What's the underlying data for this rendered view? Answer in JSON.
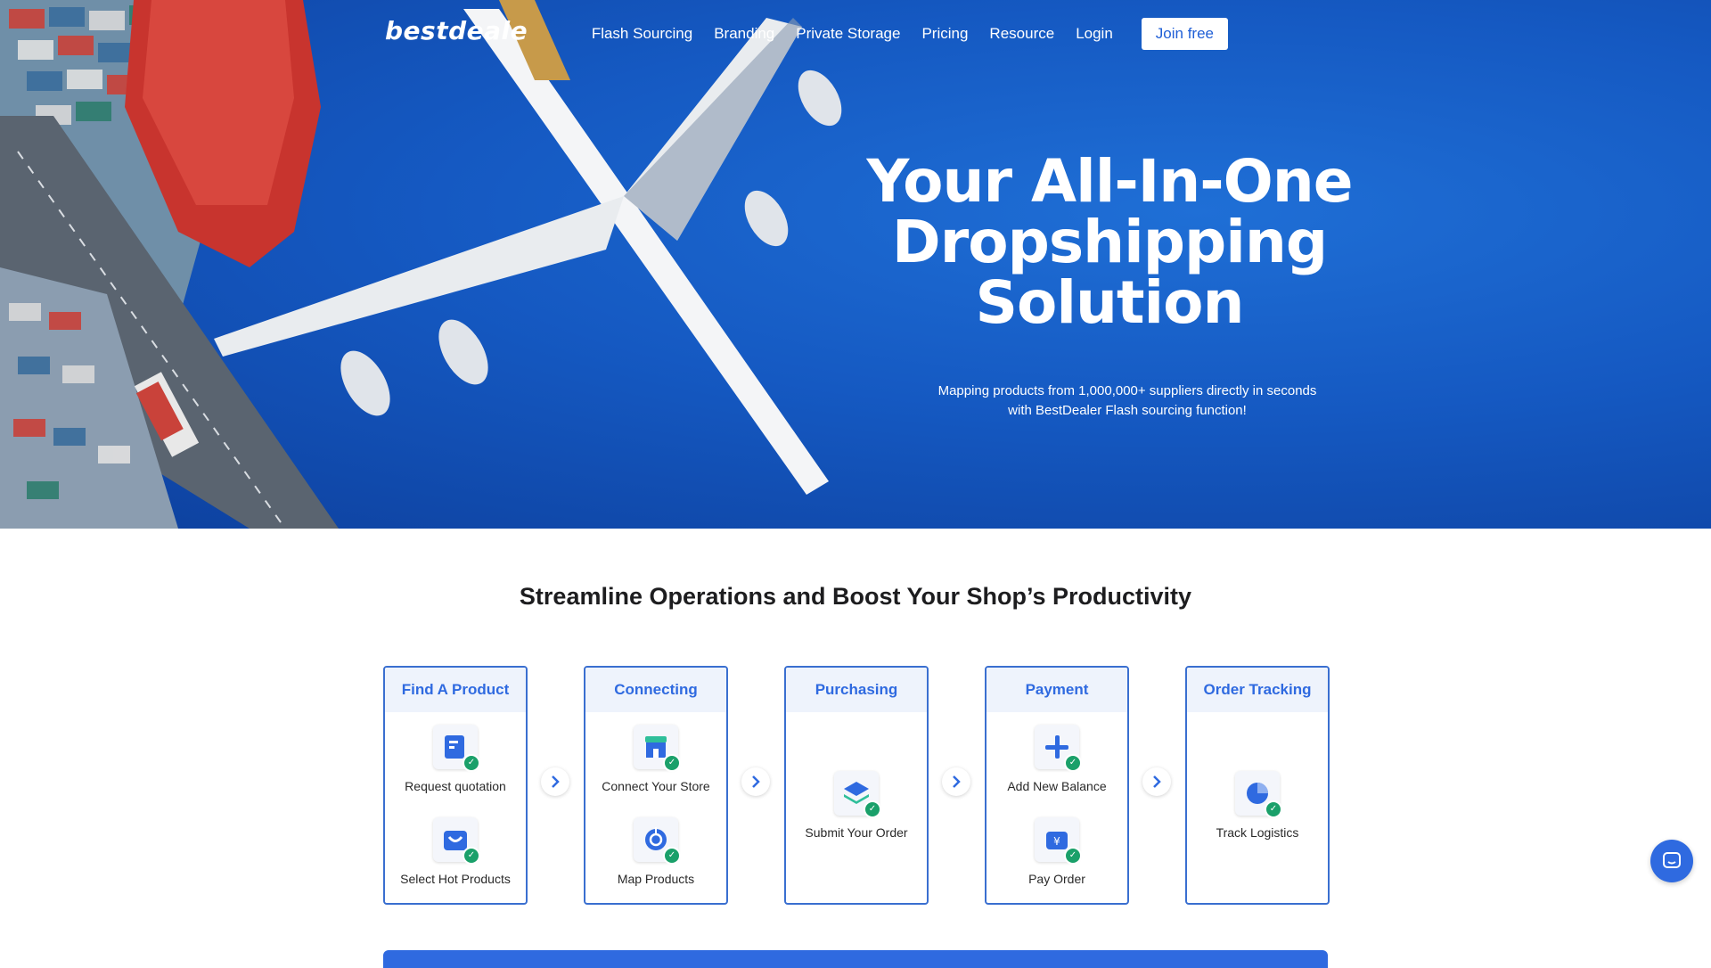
{
  "brand": {
    "logo_text": "bestdeale",
    "accent": "#2f6ae0"
  },
  "nav": {
    "items": [
      {
        "label": "Flash Sourcing"
      },
      {
        "label": "Branding"
      },
      {
        "label": "Private Storage"
      },
      {
        "label": "Pricing"
      },
      {
        "label": "Resource"
      },
      {
        "label": "Login"
      }
    ],
    "join_label": "Join free"
  },
  "hero": {
    "title_lines": [
      "Your All-In-One",
      "Dropshipping",
      "Solution"
    ],
    "subtitle_lines": [
      "Mapping products from 1,000,000+ suppliers directly in seconds",
      "with BestDealer Flash sourcing function!"
    ]
  },
  "section": {
    "title": "Streamline Operations and Boost Your Shop’s Productivity"
  },
  "steps": [
    {
      "title": "Find A Product",
      "items": [
        {
          "label": "Request quotation",
          "icon": "quotation-icon"
        },
        {
          "label": "Select Hot Products",
          "icon": "shopping-bag-icon"
        }
      ]
    },
    {
      "title": "Connecting",
      "items": [
        {
          "label": "Connect Your Store",
          "icon": "store-icon"
        },
        {
          "label": "Map Products",
          "icon": "map-target-icon"
        }
      ]
    },
    {
      "title": "Purchasing",
      "items": [
        {
          "label": "Submit Your Order",
          "icon": "layers-icon"
        }
      ]
    },
    {
      "title": "Payment",
      "items": [
        {
          "label": "Add New Balance",
          "icon": "plus-icon"
        },
        {
          "label": "Pay Order",
          "icon": "wallet-icon"
        }
      ]
    },
    {
      "title": "Order Tracking",
      "items": [
        {
          "label": "Track Logistics",
          "icon": "pie-chart-icon"
        }
      ]
    }
  ]
}
